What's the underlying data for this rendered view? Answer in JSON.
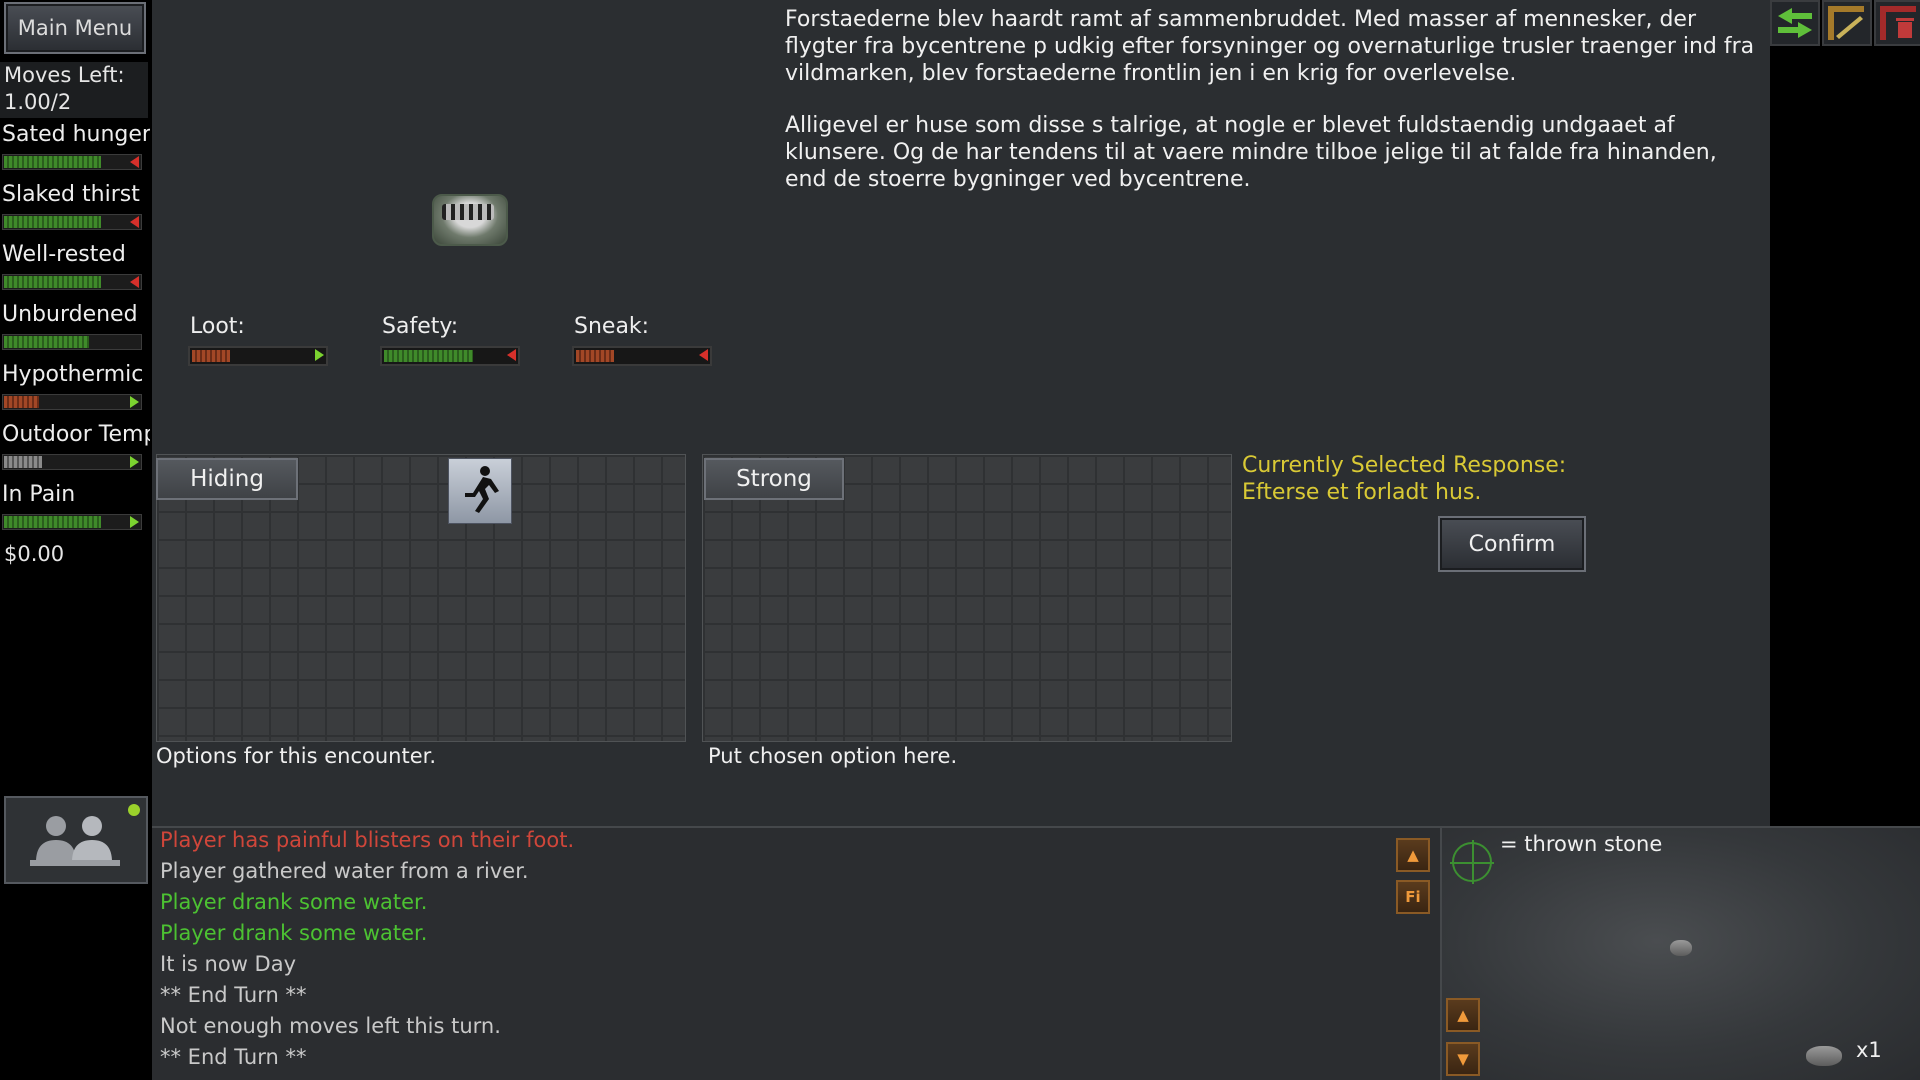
{
  "sidebar": {
    "main_menu": "Main Menu",
    "moves_label": "Moves Left:",
    "moves_value": "1.00/2",
    "stats": [
      {
        "label": "Sated hunger",
        "fill": 0.82,
        "color": "green",
        "marker": "left"
      },
      {
        "label": "Slaked thirst",
        "fill": 0.82,
        "color": "green",
        "marker": "left"
      },
      {
        "label": "Well-rested",
        "fill": 0.82,
        "color": "green",
        "marker": "left"
      },
      {
        "label": "Unburdened",
        "fill": 0.72,
        "color": "green",
        "marker": "none"
      },
      {
        "label": "Hypothermic",
        "fill": 0.3,
        "color": "red",
        "marker": "right"
      },
      {
        "label": "Outdoor Temp",
        "fill": 0.32,
        "color": "gray",
        "marker": "right"
      },
      {
        "label": "In Pain",
        "fill": 0.82,
        "color": "green",
        "marker": "right"
      }
    ],
    "money": "$0.00"
  },
  "encounter": {
    "story_p1": "Forstaederne blev haardt ramt af sammenbruddet. Med masser af mennesker, der flygter fra bycentrene p udkig efter forsyninger og overnaturlige trusler traenger ind fra vildmarken, blev forstaederne frontlin jen i en krig for overlevelse.",
    "story_p2": "Alligevel er huse som disse s talrige, at nogle er blevet fuldstaendig undgaaet af klunsere. Og de har tendens til at vaere mindre tilboe jelige til at falde fra hinanden, end de stoerre bygninger ved bycentrene.",
    "meters": [
      {
        "label": "Loot:",
        "fill": 0.32,
        "color": "red",
        "marker": "right"
      },
      {
        "label": "Safety:",
        "fill": 0.75,
        "color": "green",
        "marker": "left"
      },
      {
        "label": "Sneak:",
        "fill": 0.32,
        "color": "red",
        "marker": "left"
      }
    ],
    "options_tab": "Hiding",
    "chosen_tab": "Strong",
    "options_caption": "Options for this encounter.",
    "chosen_caption": "Put chosen option here.",
    "selected_label": "Currently Selected Response:",
    "selected_value": "Efterse et forladt hus.",
    "confirm": "Confirm"
  },
  "top_icons": [
    "swap-arrows-icon",
    "weapon-icon",
    "trash-icon"
  ],
  "log": {
    "lines": [
      {
        "text": "Player has painful blisters on their foot.",
        "color": "#d0463a"
      },
      {
        "text": "Player gathered water from a river.",
        "color": "#c9c9c9"
      },
      {
        "text": "Player drank some water.",
        "color": "#4cc232"
      },
      {
        "text": "Player drank some water.",
        "color": "#4cc232"
      },
      {
        "text": "It is now Day",
        "color": "#c9c9c9"
      },
      {
        "text": "** End Turn **",
        "color": "#c9c9c9"
      },
      {
        "text": "Not enough moves left this turn.",
        "color": "#c9c9c9"
      },
      {
        "text": "** End Turn **",
        "color": "#c9c9c9"
      }
    ],
    "filter_button": "Fi"
  },
  "inventory": {
    "legend": "= thrown stone",
    "stack_count": "x1"
  }
}
